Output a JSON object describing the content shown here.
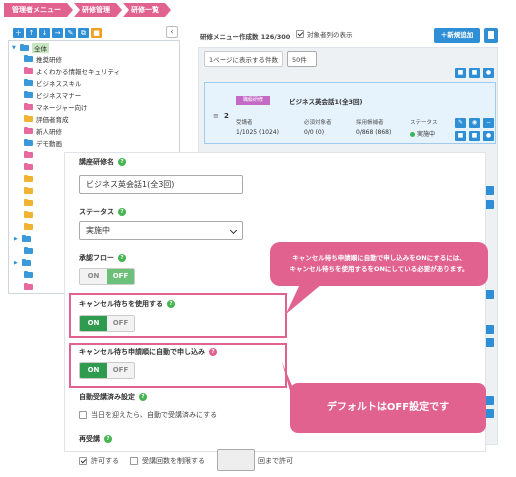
{
  "breadcrumb": [
    "管理者メニュー",
    "研修管理",
    "研修一覧"
  ],
  "tree": {
    "root": "全体",
    "items": [
      "推奨研修",
      "よくわかる情報セキュリティ",
      "ビジネススキル",
      "ビジネスマナー",
      "マネージャー向け",
      "評価者育成",
      "新人研修",
      "デモ動画"
    ],
    "collapse_glyph": "‹"
  },
  "list": {
    "count_label": "研修メニュー作成数 126/300",
    "show_target_label": "対象者列の表示",
    "new_button": "＋新規追加",
    "per_page_label": "1ページに表示する件数",
    "per_page_value": "50件",
    "course": {
      "tag": "職級研修",
      "title": "ビジネス英会話1(全3回)",
      "number": "2",
      "drag": "≡",
      "learners_label": "受講者",
      "learners_value": "1/1025 (1024)",
      "required_label": "必須対象者",
      "required_value": "0/0 (0)",
      "newcomer_label": "採用帳補者",
      "newcomer_value": "0/868 (868)",
      "status_label": "ステータス",
      "status_value": "実施中"
    }
  },
  "form": {
    "name_label": "講座研修名",
    "name_value": "ビジネス英会話1(全3回)",
    "status_label": "ステータス",
    "status_value": "実施中",
    "approval_label": "承認フロー",
    "approval_on": "ON",
    "approval_off": "OFF",
    "waitlist_label": "キャンセル待ちを使用する",
    "waitlist_on": "ON",
    "waitlist_off": "OFF",
    "auto_apply_label": "キャンセル待ち申請順に自動で申し込み",
    "auto_apply_on": "ON",
    "auto_apply_off": "OFF",
    "auto_complete_label": "自動受講済み設定",
    "auto_complete_check": "当日を迎えたら、自動で受講済みにする",
    "retake_label": "再受講",
    "allow_label": "許可する",
    "limit_label": "受講回数を制限する",
    "times_suffix": "回まで許可"
  },
  "callouts": {
    "top_line1": "キャンセル待ち申請順に自動で申し込みをONにするには、",
    "top_line2": "キャンセル待ちを使用するをONにしている必要があります。",
    "bottom": "デフォルトはOFF設定です"
  },
  "colors": {
    "pink": "#e2628f",
    "blue": "#2f8fd6",
    "green": "#2e9b4f"
  }
}
